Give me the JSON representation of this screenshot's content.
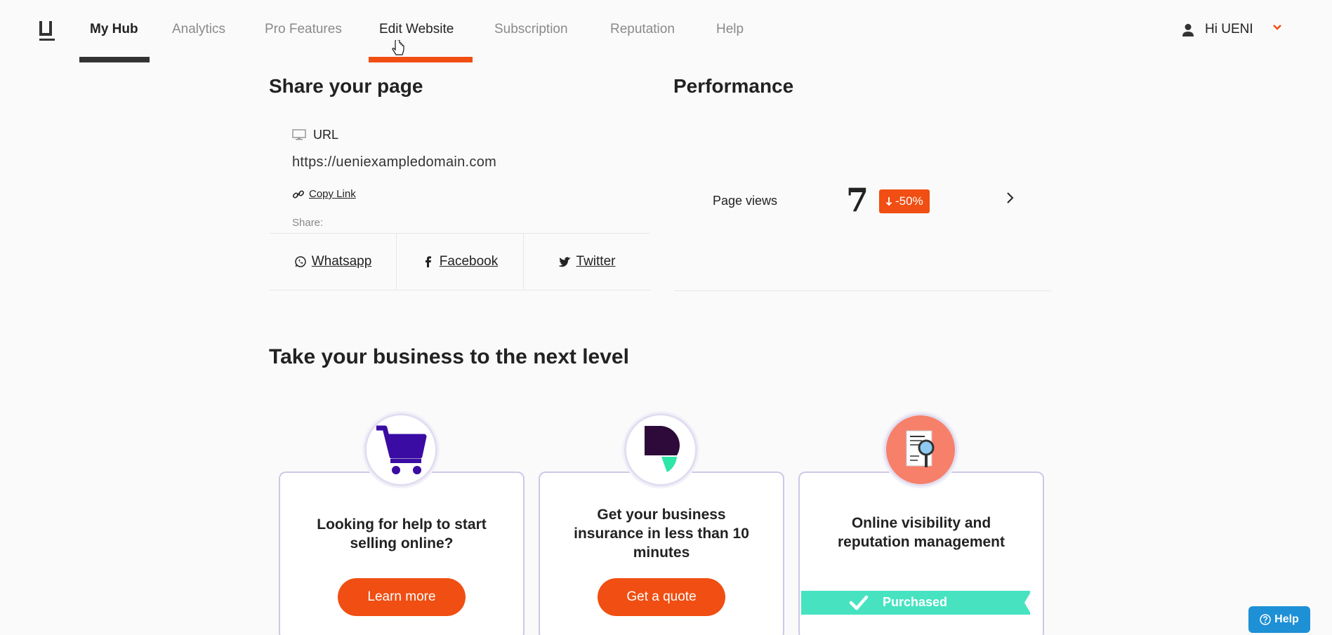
{
  "nav": {
    "items": [
      {
        "label": "My Hub"
      },
      {
        "label": "Analytics"
      },
      {
        "label": "Pro Features"
      },
      {
        "label": "Edit Website"
      },
      {
        "label": "Subscription"
      },
      {
        "label": "Reputation"
      },
      {
        "label": "Help"
      }
    ],
    "user_label": "Hi UENI",
    "accent_color": "#f04e12"
  },
  "share": {
    "title": "Share your page",
    "url_label": "URL",
    "url_value": "https://ueniexampledomain.com",
    "copy_link": "Copy Link",
    "share_label": "Share:",
    "channels": [
      {
        "label": "Whatsapp",
        "icon": "whatsapp-icon"
      },
      {
        "label": "Facebook",
        "icon": "facebook-icon"
      },
      {
        "label": "Twitter",
        "icon": "twitter-icon"
      }
    ]
  },
  "performance": {
    "title": "Performance",
    "metric_label": "Page views",
    "metric_value": "7",
    "change": "-50%"
  },
  "upsell": {
    "title": "Take your business to the next level",
    "cards": [
      {
        "title": "Looking for help to start selling online?",
        "button": "Learn more",
        "icon": "shopping-cart-icon"
      },
      {
        "title": "Get your business insurance in less than 10 minutes",
        "button": "Get a quote",
        "icon": "insurance-logo-icon"
      },
      {
        "title": "Online visibility and reputation management",
        "status": "Purchased",
        "icon": "document-search-icon"
      }
    ]
  },
  "help_button": "Help"
}
